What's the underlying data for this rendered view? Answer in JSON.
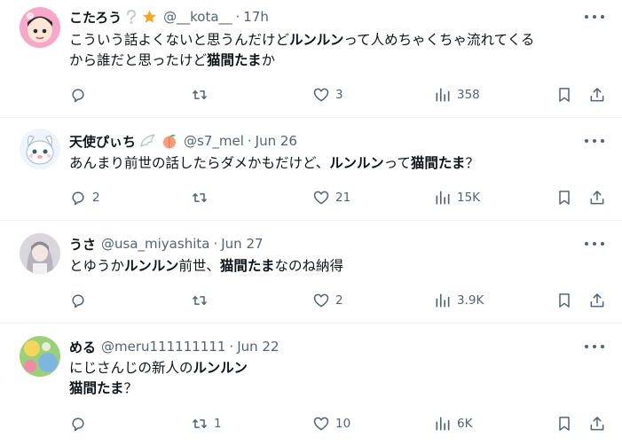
{
  "posts": [
    {
      "name": "こたろう",
      "badge_icons": [
        "question-mark-icon",
        "star-icon"
      ],
      "handle": "@__kota__",
      "dot": "·",
      "time": "17h",
      "text": [
        [
          {
            "t": "こういう話よくないと思うんだけど"
          },
          {
            "t": "ルンルン",
            "b": true
          },
          {
            "t": "って人めちゃくちゃ流れてくる"
          }
        ],
        [
          {
            "t": "から誰だと思ったけど"
          },
          {
            "t": "猫間たま",
            "b": true
          },
          {
            "t": "か"
          }
        ]
      ],
      "replies": "",
      "reposts": "",
      "likes": "3",
      "views": "358"
    },
    {
      "name": "天使ぴぃち",
      "badge_icons": [
        "wing-icon",
        "peach-icon"
      ],
      "handle": "@s7_mel",
      "dot": "·",
      "time": "Jun 26",
      "text": [
        [
          {
            "t": "あんまり前世の話したらダメかもだけど、"
          },
          {
            "t": "ルンルン",
            "b": true
          },
          {
            "t": "って"
          },
          {
            "t": "猫間たま",
            "b": true
          },
          {
            "t": "？"
          }
        ]
      ],
      "replies": "2",
      "reposts": "",
      "likes": "21",
      "views": "15K"
    },
    {
      "name": "うさ",
      "badge_icons": [],
      "handle": "@usa_miyashita",
      "dot": "·",
      "time": "Jun 27",
      "text": [
        [
          {
            "t": "とゆうか"
          },
          {
            "t": "ルンルン",
            "b": true
          },
          {
            "t": "前世、"
          },
          {
            "t": "猫間たま",
            "b": true
          },
          {
            "t": "なのね納得"
          }
        ]
      ],
      "replies": "",
      "reposts": "",
      "likes": "2",
      "views": "3.9K"
    },
    {
      "name": "める",
      "badge_icons": [],
      "handle": "@meru111111111",
      "dot": "·",
      "time": "Jun 22",
      "text": [
        [
          {
            "t": "にじさんじの新人の"
          },
          {
            "t": "ルンルン",
            "b": true
          }
        ],
        [
          {
            "t": "猫間たま",
            "b": true
          },
          {
            "t": "？"
          }
        ]
      ],
      "replies": "",
      "reposts": "1",
      "likes": "10",
      "views": "6K"
    }
  ],
  "colors": {
    "text": "#0f1419",
    "muted": "#536471",
    "divider": "#eff3f4",
    "star": "#f5a623"
  }
}
